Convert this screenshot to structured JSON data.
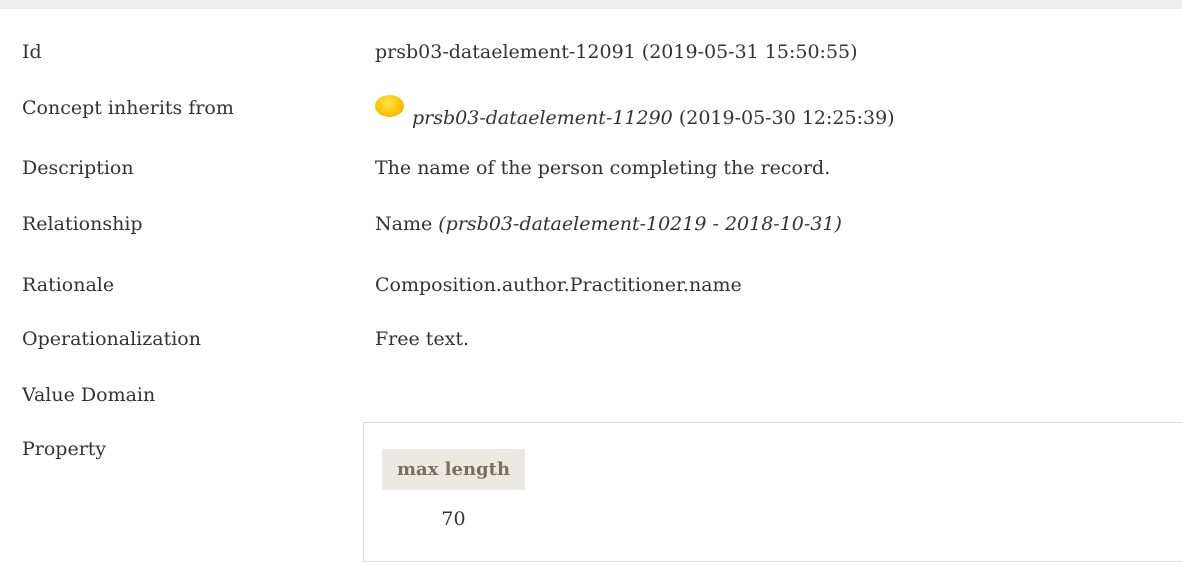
{
  "rows": [
    {
      "label": "Id",
      "value": "prsb03-dataelement-12091 (2019-05-31 15:50:55)"
    },
    {
      "label": "Concept inherits from",
      "inherits_id": "prsb03-dataelement-11290",
      "inherits_date": " (2019-05-30 12:25:39)"
    },
    {
      "label": "Description",
      "value": "The name of the person completing the record."
    },
    {
      "label": "Relationship",
      "value_plain": "Name ",
      "value_italic": "(prsb03-dataelement-10219 - 2018-10-31)"
    },
    {
      "label": "Rationale",
      "value": "Composition.author.Practitioner.name"
    },
    {
      "label": "Operationalization",
      "value": "Free text."
    },
    {
      "label": "Value Domain"
    },
    {
      "label": "Property"
    }
  ],
  "property_table": {
    "header": "max length",
    "value": "70"
  },
  "colors": {
    "status_orb": "#ffc400",
    "header_bg": "#ece9e4",
    "header_text": "#7a6e5f",
    "top_strip": "#eeeeee"
  },
  "icons": {
    "status_orb": "status-orb-icon"
  }
}
